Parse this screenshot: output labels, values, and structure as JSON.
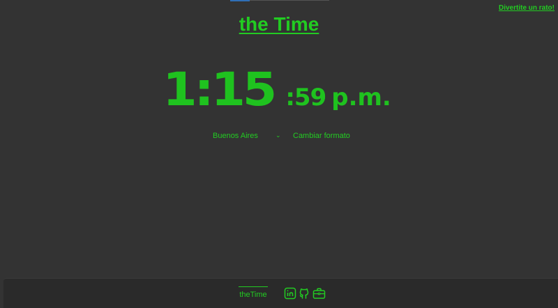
{
  "header": {
    "fun_link": "Divertite un rato!",
    "title": "the Time"
  },
  "clock": {
    "hours_minutes": "1:15",
    "seconds": ":59",
    "ampm": "p.m."
  },
  "controls": {
    "city": "Buenos Aires",
    "format_button": "Cambiar formato"
  },
  "footer": {
    "brand": "theTime",
    "icons": [
      "linkedin-icon",
      "github-icon",
      "briefcase-icon"
    ]
  },
  "colors": {
    "background": "#333333",
    "accent": "#22cc22",
    "footer_background": "#2a2a2a"
  }
}
